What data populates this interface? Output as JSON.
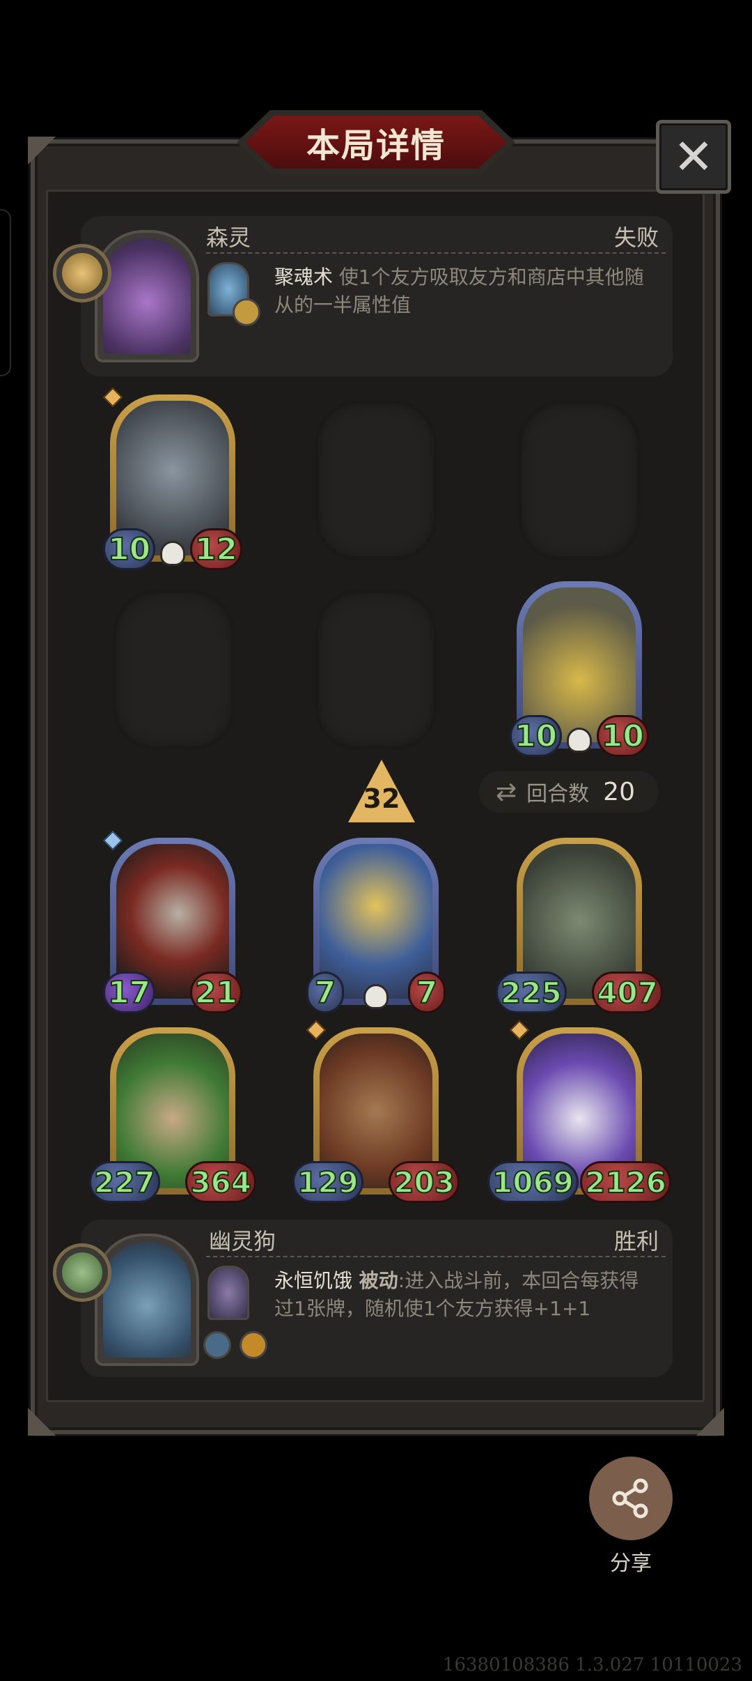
{
  "dialog": {
    "title": "本局详情",
    "close_glyph": "✕"
  },
  "opponent": {
    "name": "森灵",
    "result": "失败",
    "skill_name": "聚魂术",
    "skill_desc": " 使1个友方吸取友方和商店中其他随从的一半属性值"
  },
  "board_top": {
    "cards": [
      {
        "attack": "10",
        "health": "12",
        "frame": "gold",
        "art_color": "#5f6a74"
      },
      {
        "attack": "10",
        "health": "10",
        "frame": "blue",
        "art_color": "#6d6a55"
      }
    ]
  },
  "center": {
    "level": "32",
    "turn_label": "回合数",
    "turn_value": "20",
    "turn_icon": "swap-icon"
  },
  "board_bottom": {
    "cards": [
      {
        "attack": "17",
        "health": "21",
        "frame": "blue",
        "art_color": "#5a2a26"
      },
      {
        "attack": "7",
        "health": "7",
        "frame": "blue",
        "art_color": "#4b5a7a"
      },
      {
        "attack": "225",
        "health": "407",
        "frame": "gold",
        "art_color": "#4b5246"
      },
      {
        "attack": "227",
        "health": "364",
        "frame": "gold",
        "art_color": "#4e6a3a"
      },
      {
        "attack": "129",
        "health": "203",
        "frame": "gold",
        "art_color": "#7a4a2e"
      },
      {
        "attack": "1069",
        "health": "2126",
        "frame": "gold",
        "art_color": "#4a3e78"
      }
    ]
  },
  "player": {
    "name": "幽灵狗",
    "result": "胜利",
    "skill_name": "永恒饥饿",
    "skill_keyword": " 被动",
    "skill_desc": ":进入战斗前，本回合每获得过1张牌，随机使1个友方获得+1+1"
  },
  "share": {
    "label": "分享",
    "icon": "share-icon"
  },
  "footer": {
    "build_id": "16380108386 1.3.027 10110023"
  },
  "colors": {
    "stat_text": "#9be68a",
    "title_banner": "#7a1717",
    "gold_frame": "#c9a04a",
    "blue_frame": "#6c7bb5"
  }
}
